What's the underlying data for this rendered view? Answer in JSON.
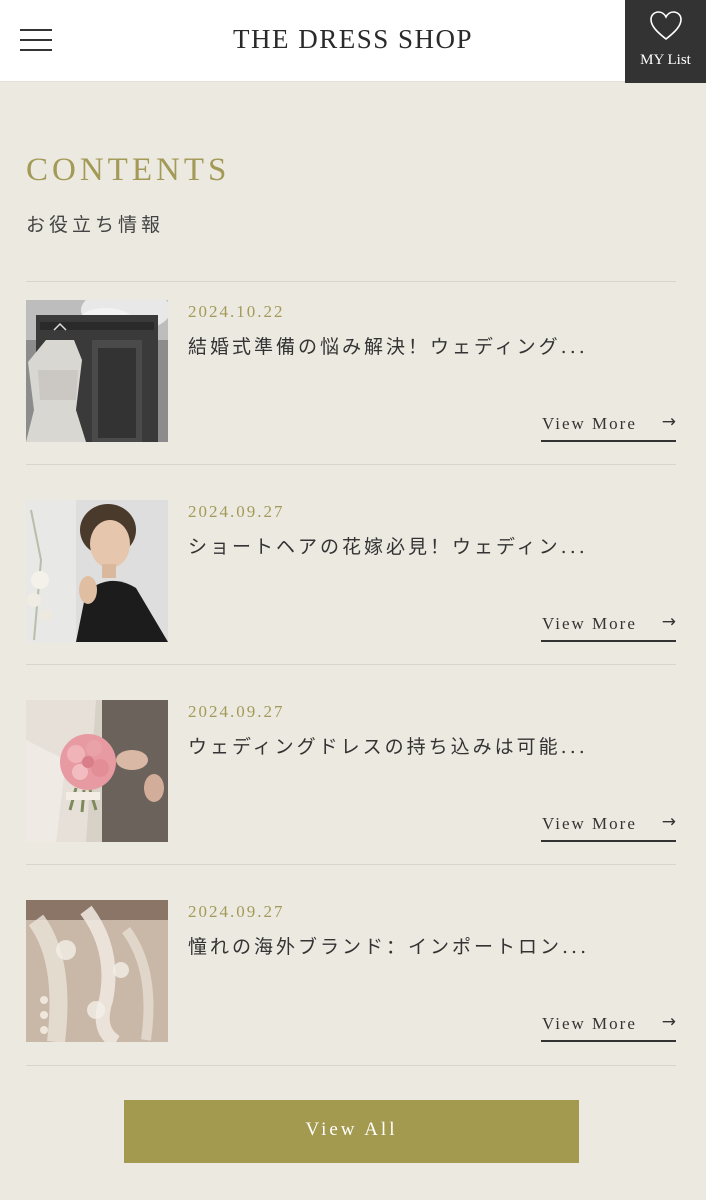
{
  "header": {
    "logo": "THE DRESS SHOP",
    "mylist_label": "MY List"
  },
  "section": {
    "title": "CONTENTS",
    "subtitle": "お役立ち情報"
  },
  "articles": [
    {
      "date": "2024.10.22",
      "title": "結婚式準備の悩み解決！ウェディング...",
      "view_more": "View More",
      "image": "wedding-dress-hanging-photo"
    },
    {
      "date": "2024.09.27",
      "title": "ショートヘアの花嫁必見！ウェディン...",
      "view_more": "View More",
      "image": "short-hair-woman-photo"
    },
    {
      "date": "2024.09.27",
      "title": "ウェディングドレスの持ち込みは可能...",
      "view_more": "View More",
      "image": "bride-bouquet-photo"
    },
    {
      "date": "2024.09.27",
      "title": "憧れの海外ブランド：インポートロン...",
      "view_more": "View More",
      "image": "lace-dress-detail-photo"
    }
  ],
  "view_all": "View All",
  "colors": {
    "background": "#ece9e0",
    "accent": "#a39a58",
    "button": "#a39a4f",
    "mylist_bg": "#333333"
  }
}
